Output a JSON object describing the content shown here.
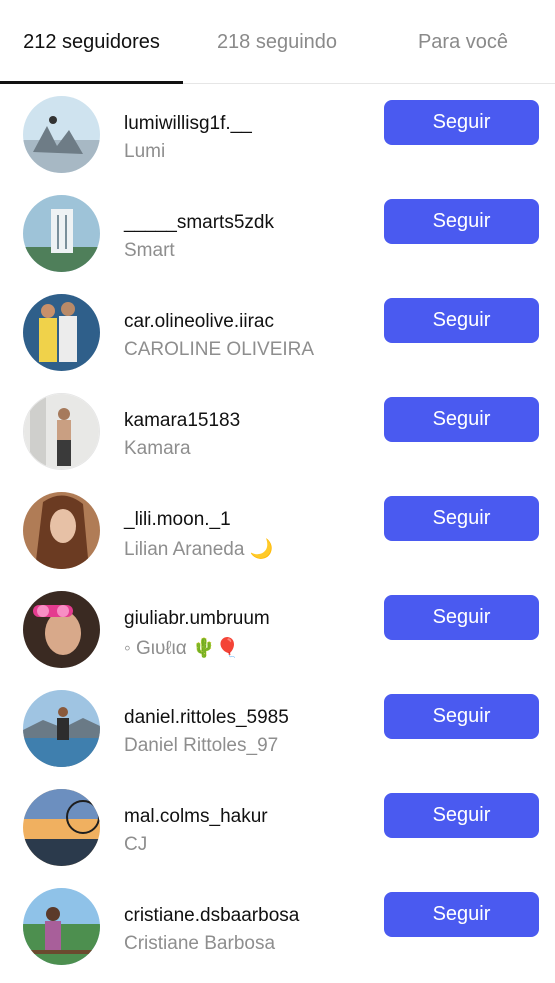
{
  "tabs": [
    {
      "label": "212 seguidores"
    },
    {
      "label": "218 seguindo"
    },
    {
      "label": "Para você"
    }
  ],
  "accent_color": "#4a5af0",
  "rows": [
    {
      "username": "lumiwillisg1f.__",
      "fullname": "Lumi",
      "button": "Seguir"
    },
    {
      "username": "_____smarts5zdk",
      "fullname": "Smart",
      "button": "Seguir"
    },
    {
      "username": "car.olineolive.iirac",
      "fullname": "CAROLINE OLIVEIRA",
      "button": "Seguir"
    },
    {
      "username": "kamara15183",
      "fullname": "Kamara",
      "button": "Seguir"
    },
    {
      "username": "_lili.moon._1",
      "fullname": "Lilian Araneda 🌙",
      "button": "Seguir"
    },
    {
      "username": "giuliabr.umbruum",
      "fullname": "◦ Gιυℓια 🌵🎈",
      "button": "Seguir"
    },
    {
      "username": "daniel.rittoles_5985",
      "fullname": "Daniel Rittoles_97",
      "button": "Seguir"
    },
    {
      "username": "mal.colms_hakur",
      "fullname": "CJ",
      "button": "Seguir"
    },
    {
      "username": "cristiane.dsbaarbosa",
      "fullname": "Cristiane Barbosa",
      "button": "Seguir"
    }
  ]
}
